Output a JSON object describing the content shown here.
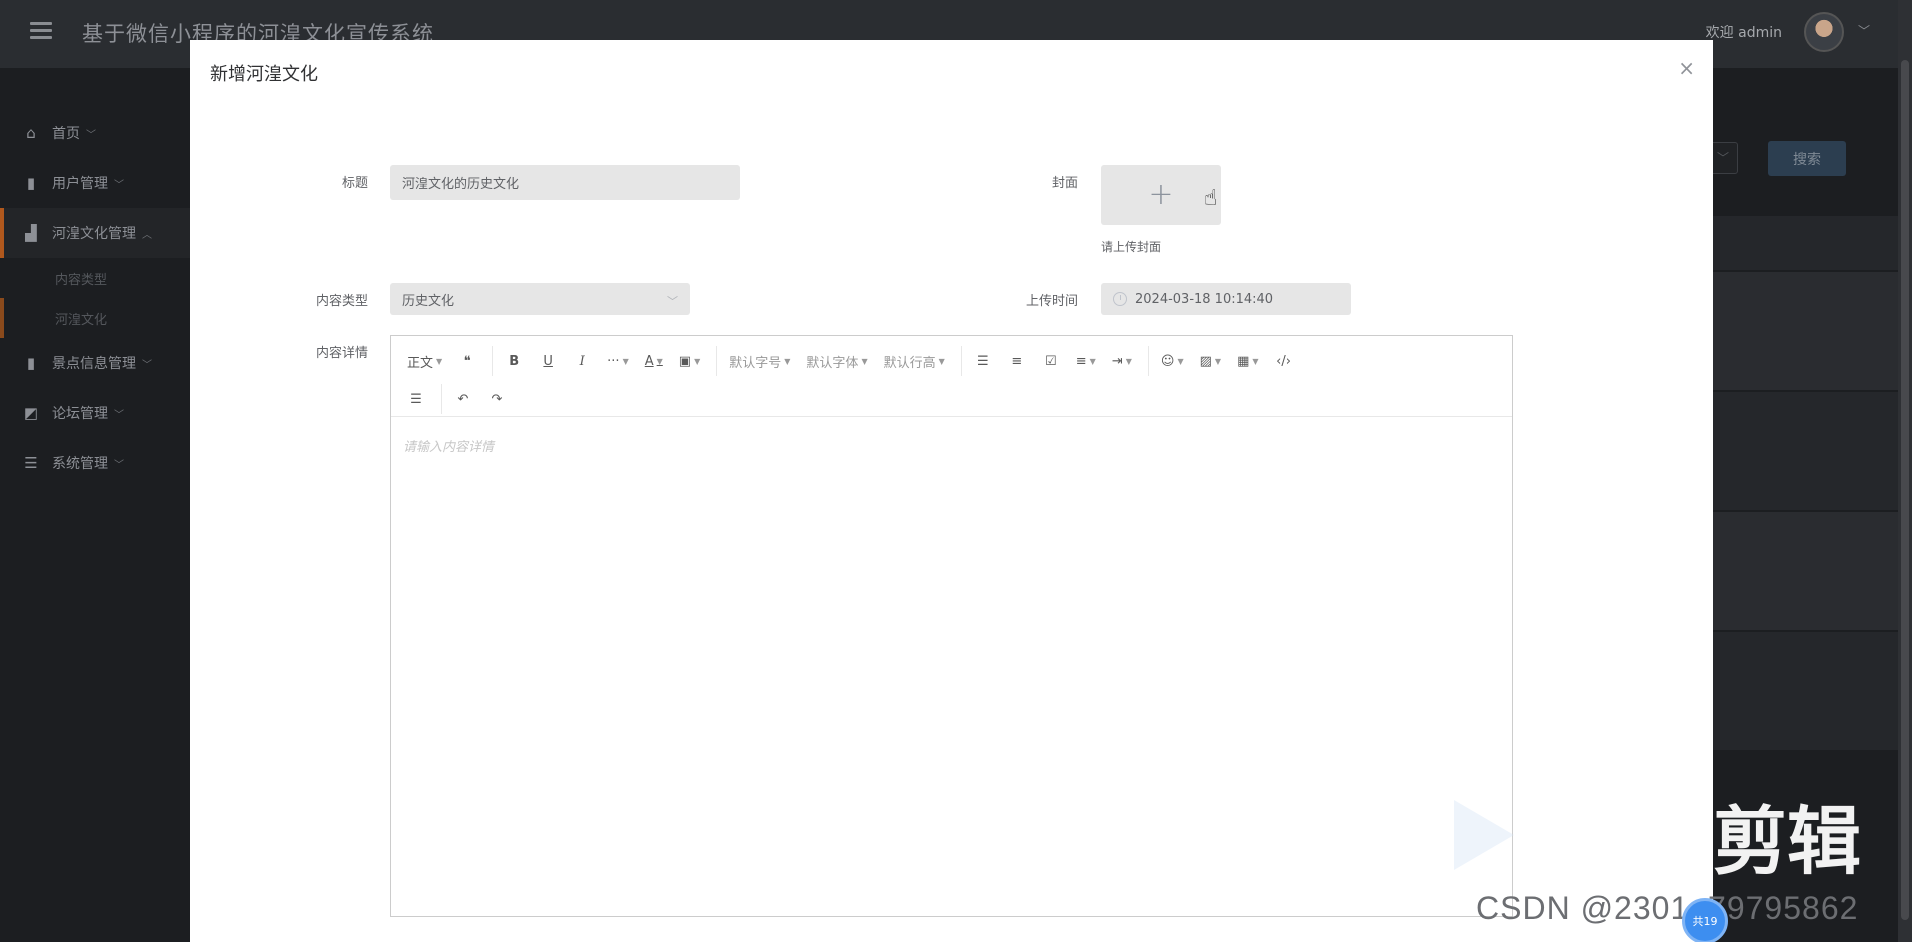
{
  "app": {
    "title": "基于微信小程序的河湟文化宣传系统",
    "welcome": "欢迎 admin"
  },
  "sidebar": {
    "items": [
      {
        "label": "首页",
        "icon": "home-icon"
      },
      {
        "label": "用户管理",
        "icon": "book-icon"
      },
      {
        "label": "河湟文化管理",
        "icon": "chart-icon",
        "active": true
      },
      {
        "label": "景点信息管理",
        "icon": "book-icon"
      },
      {
        "label": "论坛管理",
        "icon": "edit-icon"
      },
      {
        "label": "系统管理",
        "icon": "server-icon"
      }
    ],
    "subitems": [
      "内容类型",
      "河湟文化"
    ]
  },
  "background": {
    "search_button": "搜索"
  },
  "modal": {
    "title": "新增河湟文化",
    "close": "×",
    "form": {
      "title_label": "标题",
      "title_value": "河湟文化的历史文化",
      "cover_label": "封面",
      "cover_tip": "请上传封面",
      "type_label": "内容类型",
      "type_value": "历史文化",
      "time_label": "上传时间",
      "time_value": "2024-03-18 10:14:40",
      "content_label": "内容详情",
      "content_placeholder": "请输入内容详情"
    },
    "toolbar": {
      "paragraph": "正文",
      "font_size": "默认字号",
      "font_family": "默认字体",
      "line_height": "默认行高"
    }
  },
  "watermark": {
    "text": "剪辑",
    "csdn": "CSDN @2301_79795862",
    "badge": "共19"
  }
}
